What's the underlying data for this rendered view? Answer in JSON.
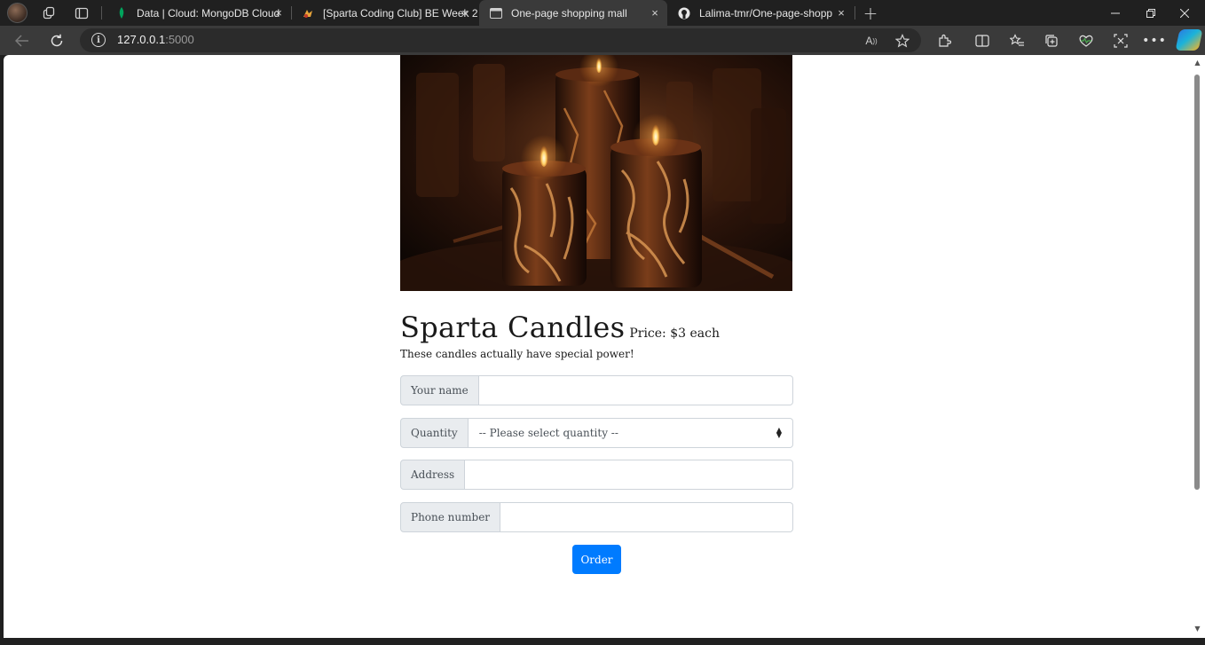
{
  "browser": {
    "tabs": [
      {
        "label": "Data | Cloud: MongoDB Cloud",
        "active": false
      },
      {
        "label": "[Sparta Coding Club] BE Week 2",
        "active": false
      },
      {
        "label": "One-page shopping mall",
        "active": true
      },
      {
        "label": "Lalima-tmr/One-page-shopping",
        "active": false
      }
    ],
    "new_tab_symbol": "+",
    "close_symbol": "×",
    "url_host": "127.0.0.1",
    "url_port": ":5000",
    "icons": [
      "workspaces-icon",
      "vertical-tabs-icon",
      "back-icon",
      "reload-icon",
      "info-icon",
      "read-aloud-icon",
      "favorite-star-icon",
      "extensions-icon",
      "split-screen-icon",
      "favorites-icon",
      "collections-icon",
      "browser-essentials-icon",
      "screenshot-icon",
      "more-icon",
      "copilot-icon"
    ]
  },
  "page": {
    "title": "Sparta Candles",
    "price": "Price: $3 each",
    "description": "These candles actually have special power!",
    "form": {
      "name_label": "Your name",
      "name_value": "",
      "quantity_label": "Quantity",
      "quantity_selected": "-- Please select quantity --",
      "address_label": "Address",
      "address_value": "",
      "phone_label": "Phone number",
      "phone_value": "",
      "order_label": "Order"
    },
    "accent_color": "#007bff"
  }
}
